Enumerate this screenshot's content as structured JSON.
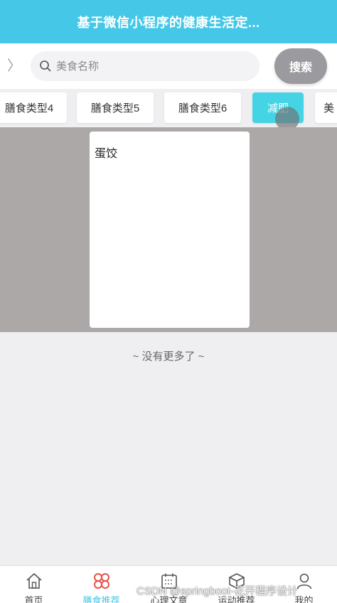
{
  "header": {
    "title": "基于微信小程序的健康生活定..."
  },
  "search": {
    "placeholder": "美食名称",
    "button_label": "搜索"
  },
  "category_tabs": [
    {
      "label": "膳食类型4",
      "active": false
    },
    {
      "label": "膳食类型5",
      "active": false
    },
    {
      "label": "膳食类型6",
      "active": false
    },
    {
      "label": "减肥",
      "active": true
    },
    {
      "label": "美",
      "active": false
    }
  ],
  "food_list": [
    {
      "name": "蛋饺"
    }
  ],
  "list_footer": "~ 没有更多了 ~",
  "tabbar": {
    "items": [
      {
        "label": "首页",
        "icon": "home-icon",
        "active": false
      },
      {
        "label": "膳食推荐",
        "icon": "clover-icon",
        "active": true
      },
      {
        "label": "心理文章",
        "icon": "calendar-icon",
        "active": false
      },
      {
        "label": "运动推荐",
        "icon": "cube-icon",
        "active": false
      },
      {
        "label": "我的",
        "icon": "user-icon",
        "active": false
      }
    ]
  },
  "watermark": "CSDN @springboot-花开程序设计",
  "colors": {
    "primary": "#45c8e8",
    "active_tab": "#45d4e6",
    "search_button": "#9a9a9f",
    "list_background": "#aba8a7"
  }
}
